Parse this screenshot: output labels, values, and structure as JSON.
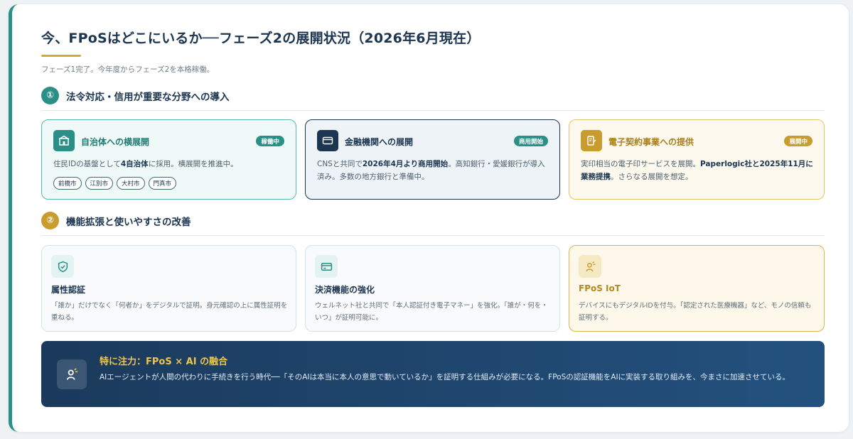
{
  "header": {
    "title": "今、FPoSはどこにいるか──フェーズ2の展開状況（2026年6月現在）",
    "subtitle": "フェーズ1完了。今年度からフェーズ2を本格稼働。"
  },
  "section1": {
    "number": "①",
    "title": "法令対応・信用が重要な分野への導入",
    "cards": [
      {
        "title": "自治体への横展開",
        "badge": "稼働中",
        "icon": "building-icon",
        "text_before": "住民IDの基盤として",
        "text_bold": "4自治体",
        "text_after": "に採用。横展開を推進中。",
        "tags": [
          "前橋市",
          "江別市",
          "大村市",
          "門真市"
        ],
        "accent": "#2a8f86"
      },
      {
        "title": "金融機関への展開",
        "badge": "商用開始",
        "icon": "card-icon",
        "text_before": "CNSと共同で",
        "text_bold": "2026年4月より商用開始",
        "text_after": "。高知銀行・愛媛銀行が導入済み。多数の地方銀行と準備中。",
        "accent": "#1c3550"
      },
      {
        "title": "電子契約事業への提供",
        "badge": "展開中",
        "icon": "document-sign-icon",
        "text_before": "実印相当の電子印サービスを展開。",
        "text_bold": "Paperlogic社と2025年11月に業務提携",
        "text_after": "。さらなる展開を想定。",
        "accent": "#c99c2e"
      }
    ]
  },
  "section2": {
    "number": "②",
    "title": "機能拡張と使いやすさの改善",
    "cards": [
      {
        "title": "属性認証",
        "icon": "shield-check-icon",
        "text": "「誰か」だけでなく「何者か」をデジタルで証明。身元確認の上に属性証明を重ねる。"
      },
      {
        "title": "決済機能の強化",
        "icon": "card-icon",
        "text": "ウェルネット社と共同で「本人認証付き電子マネー」を強化。「誰が・何を・いつ」が証明可能に。"
      },
      {
        "title": "FPoS IoT",
        "icon": "iot-person-icon",
        "text": "デバイスにもデジタルIDを付与。「認定された医療機器」など、モノの信頼も証明する。"
      }
    ]
  },
  "banner": {
    "title": "特に注力：FPoS × AI の融合",
    "icon": "ai-person-icon",
    "text": "AIエージェントが人間の代わりに手続きを行う時代──「そのAIは本当に本人の意思で動いているか」を証明する仕組みが必要になる。FPoSの認証機能をAIに実装する取り組みを、今まさに加速させている。"
  },
  "colors": {
    "teal": "#2a8f86",
    "navy": "#1c3550",
    "gold": "#c99c2e",
    "banner_gradient_start": "#1b3a5c",
    "banner_gradient_end": "#23517e"
  }
}
